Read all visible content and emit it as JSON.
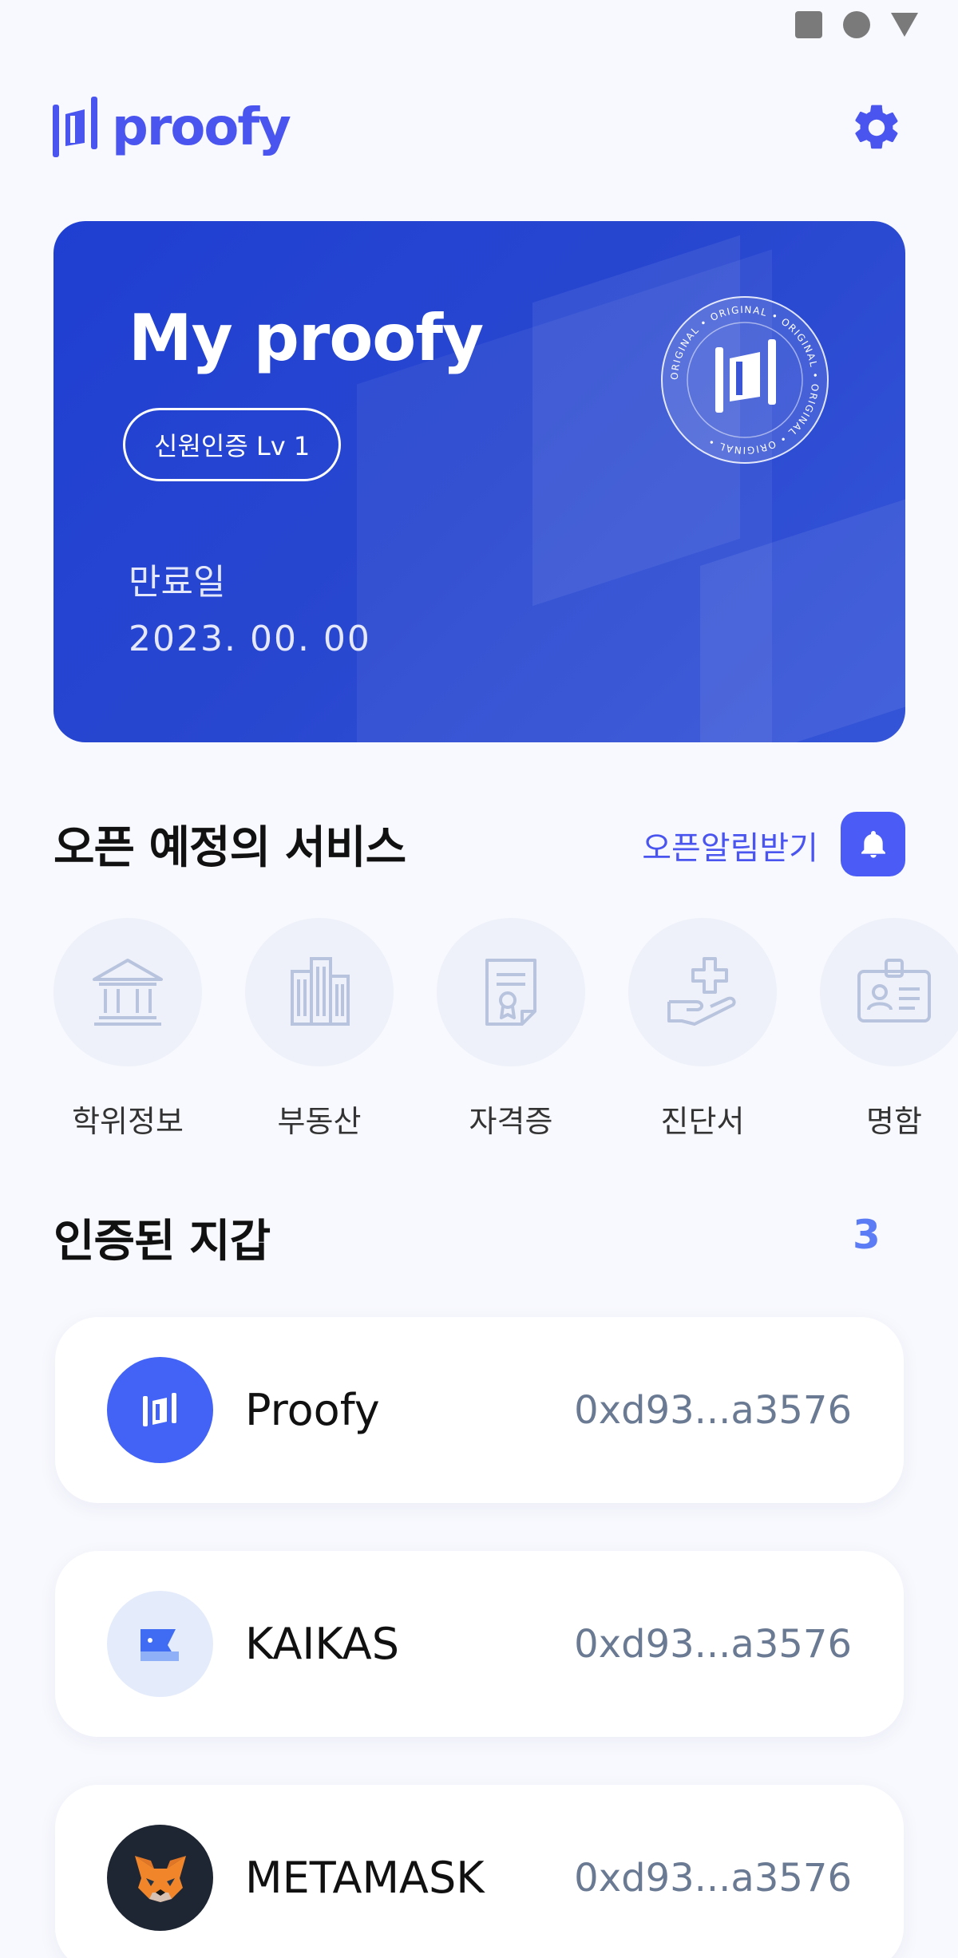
{
  "header": {
    "logo_text": "proofy",
    "brand_color": "#4a55f0"
  },
  "card": {
    "title": "My proofy",
    "badge": "신원인증 Lv 1",
    "expiry_label": "만료일",
    "expiry_date": "2023. 00. 00",
    "seal_text": "ORIGINAL"
  },
  "services": {
    "title": "오픈 예정의 서비스",
    "notify_label": "오픈알림받기",
    "items": [
      {
        "label": "학위정보",
        "icon": "bank-icon"
      },
      {
        "label": "부동산",
        "icon": "building-icon"
      },
      {
        "label": "자격증",
        "icon": "certificate-icon"
      },
      {
        "label": "진단서",
        "icon": "medical-hand-icon"
      },
      {
        "label": "명함",
        "icon": "id-badge-icon"
      }
    ]
  },
  "wallets": {
    "title": "인증된 지갑",
    "count": "3",
    "items": [
      {
        "name": "Proofy",
        "address": "0xd93...a3576",
        "icon": "proofy-logo-icon"
      },
      {
        "name": "KAIKAS",
        "address": "0xd93...a3576",
        "icon": "kaikas-logo-icon"
      },
      {
        "name": "METAMASK",
        "address": "0xd93...a3576",
        "icon": "metamask-fox-icon"
      }
    ]
  }
}
